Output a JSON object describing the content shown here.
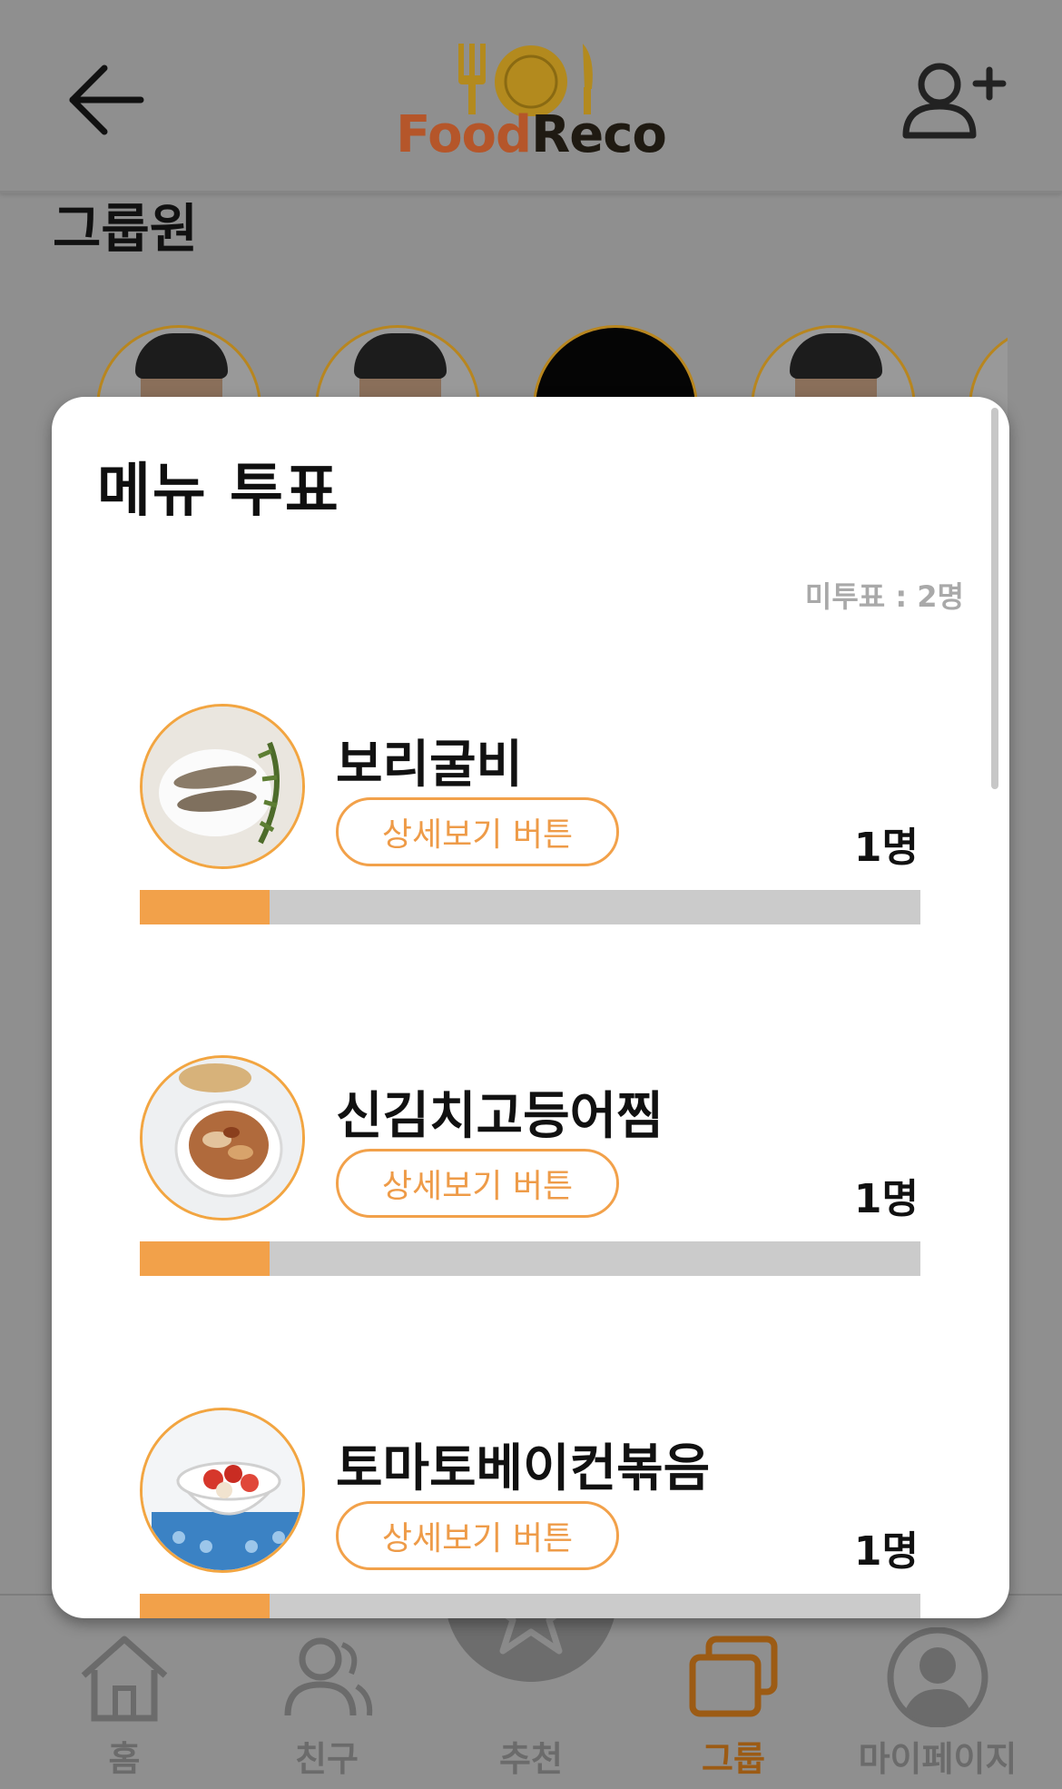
{
  "header": {
    "logo_food": "Food",
    "logo_reco": "Reco"
  },
  "group": {
    "members_title": "그룹원"
  },
  "modal": {
    "title": "메뉴 투표",
    "unvoted": "미투표 : 2명",
    "items": [
      {
        "name": "보리굴비",
        "detail_label": "상세보기 버튼",
        "count": "1명",
        "progress": 0.166
      },
      {
        "name": "신김치고등어찜",
        "detail_label": "상세보기 버튼",
        "count": "1명",
        "progress": 0.166
      },
      {
        "name": "토마토베이컨볶음",
        "detail_label": "상세보기 버튼",
        "count": "1명",
        "progress": 0.166
      }
    ]
  },
  "nav": {
    "home": "홈",
    "friends": "친구",
    "recommend": "추천",
    "group": "그룹",
    "mypage": "마이페이지"
  },
  "colors": {
    "accent": "#f2a14a",
    "overlay_bg": "#8f8f8f",
    "active_nav": "#9c5b14"
  }
}
